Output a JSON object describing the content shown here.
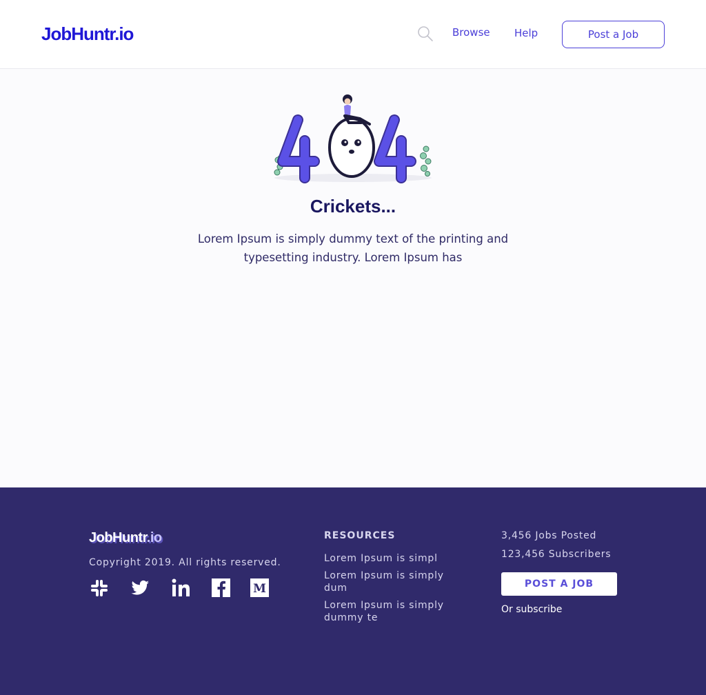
{
  "header": {
    "logo_main": "JobHuntr",
    "logo_suffix": ".io",
    "nav": {
      "browse": "Browse",
      "help": "Help"
    },
    "post_job_label": "Post a Job",
    "search_icon": "search-icon"
  },
  "main": {
    "illustration_text": "404",
    "title": "Crickets...",
    "body": "Lorem Ipsum is simply dummy text of the printing and typesetting industry. Lorem Ipsum has"
  },
  "footer": {
    "logo_main": "JobHuntr",
    "logo_suffix": ".io",
    "copyright": "Copyright 2019. All rights reserved.",
    "social": [
      "slack-icon",
      "twitter-icon",
      "linkedin-icon",
      "facebook-icon",
      "medium-icon"
    ],
    "resources_title": "RESOURCES",
    "resources": [
      "Lorem Ipsum is simpl",
      "Lorem Ipsum is simply dum",
      "Lorem Ipsum is simply dummy te"
    ],
    "jobs_posted": "3,456 Jobs Posted",
    "subscribers": "123,456 Subscribers",
    "post_job_label": "POST A JOB",
    "subscribe_label": "Or subscribe"
  },
  "colors": {
    "brand": "#1f17d6",
    "accent": "#4b3fd8",
    "footer_bg": "#302a6b"
  }
}
